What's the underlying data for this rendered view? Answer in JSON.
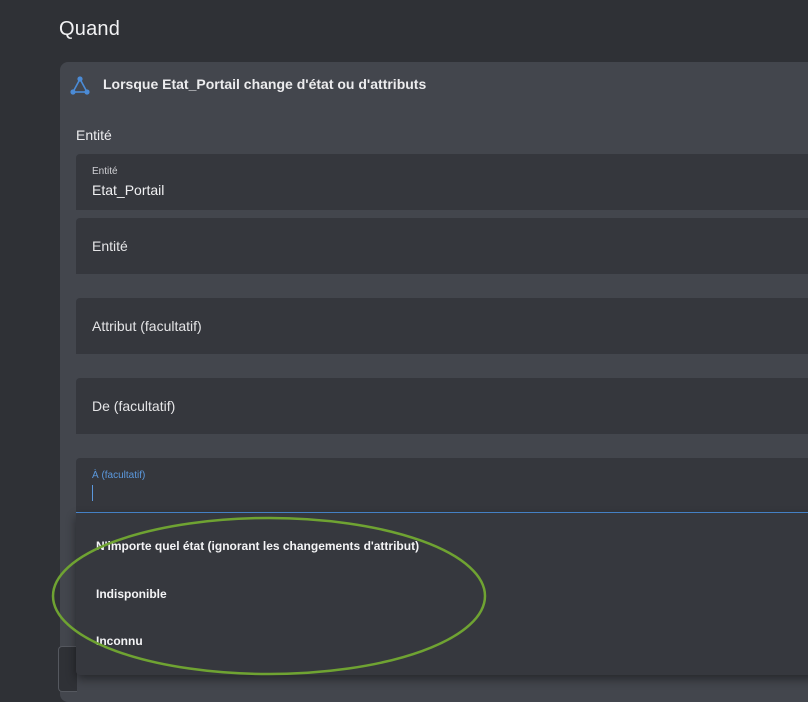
{
  "section": {
    "title": "Quand"
  },
  "trigger": {
    "title": "Lorsque Etat_Portail change d'état ou d'attributs",
    "icon": "state-trigger-icon"
  },
  "form": {
    "entity_section_label": "Entité",
    "entity_field": {
      "label": "Entité",
      "value": "Etat_Portail"
    },
    "add_entity_field": {
      "label": "Entité"
    },
    "attribute_field": {
      "label": "Attribut (facultatif)"
    },
    "from_field": {
      "label": "De (facultatif)"
    },
    "to_field": {
      "label": "À (facultatif)",
      "value": ""
    }
  },
  "dropdown": {
    "options": [
      {
        "label": "N'importe quel état (ignorant les changements d'attribut)"
      },
      {
        "label": "Indisponible"
      },
      {
        "label": "Inconnu"
      }
    ]
  },
  "colors": {
    "background": "#2f3136",
    "card": "#43464d",
    "field": "#35373d",
    "accent": "#4b8bd6",
    "highlight": "#6fa332"
  }
}
